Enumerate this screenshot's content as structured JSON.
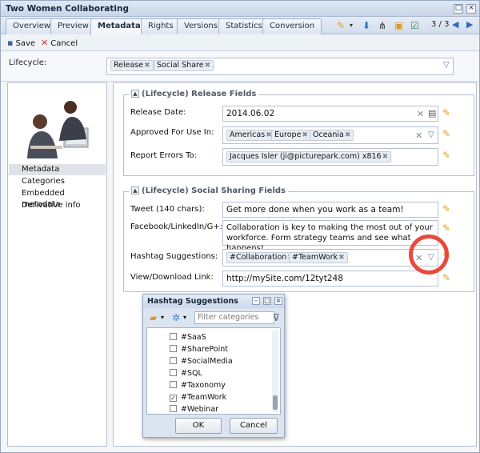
{
  "window": {
    "title": "Two Women Collaborating"
  },
  "tabs": [
    {
      "label": "Overview"
    },
    {
      "label": "Preview"
    },
    {
      "label": "Metadata"
    },
    {
      "label": "Rights"
    },
    {
      "label": "Versions"
    },
    {
      "label": "Statistics"
    },
    {
      "label": "Conversion"
    }
  ],
  "pager": "3 / 3",
  "actions": {
    "save": "Save",
    "cancel": "Cancel"
  },
  "lifecycle": {
    "label": "Lifecycle:",
    "chips": [
      "Release",
      "Social Share"
    ]
  },
  "nav": [
    "Metadata",
    "Categories",
    "Embedded metadata",
    "Derivative info"
  ],
  "release": {
    "title": "(Lifecycle) Release Fields",
    "date_label": "Release Date:",
    "date_value": "2014.06.02",
    "approved_label": "Approved For Use In:",
    "approved_chips": [
      "Americas",
      "Europe",
      "Oceania"
    ],
    "errors_label": "Report Errors To:",
    "errors_chip": "Jacques Isler (ji@picturepark.com) x816"
  },
  "social": {
    "title": "(Lifecycle) Social Sharing Fields",
    "tweet_label": "Tweet (140 chars):",
    "tweet_value": "Get more done when you work as a team!",
    "facebook_label": "Facebook/LinkedIn/G+:",
    "facebook_value": "Collaboration is key to making the most out of your workforce. Form strategy teams and see what happens!",
    "hashtag_label": "Hashtag Suggestions:",
    "hashtag_chips": [
      "#Collaboration",
      "#TeamWork"
    ],
    "link_label": "View/Download Link:",
    "link_value": "http://mySite.com/12tyt248"
  },
  "popup": {
    "title": "Hashtag Suggestions",
    "filter_placeholder": "Filter categories",
    "items": [
      {
        "label": "#SaaS",
        "checked": false
      },
      {
        "label": "#SharePoint",
        "checked": false
      },
      {
        "label": "#SocialMedia",
        "checked": false
      },
      {
        "label": "#SQL",
        "checked": false
      },
      {
        "label": "#Taxonomy",
        "checked": false
      },
      {
        "label": "#TeamWork",
        "checked": true
      },
      {
        "label": "#Webinar",
        "checked": false
      }
    ],
    "ok": "OK",
    "cancel": "Cancel"
  },
  "colors": {
    "accent": "#2f6fb6",
    "highlight_ring": "#e8493c",
    "pencil": "#e2a21c"
  },
  "icons": {
    "save": "floppy-disk-icon",
    "cancel": "red-x-icon",
    "edit": "pencil-icon",
    "dropdown": "chevron-down-icon",
    "clear": "clear-x-icon"
  }
}
